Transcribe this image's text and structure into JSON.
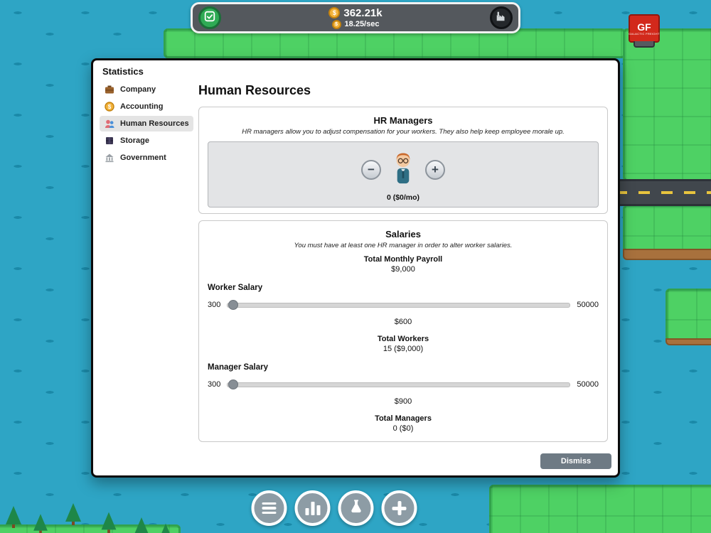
{
  "hud": {
    "money": "362.21k",
    "income_rate": "18.25/sec",
    "coin_symbol": "$"
  },
  "map": {
    "truck_logo": "GF",
    "truck_caption": "GALACTIC FREIGHT"
  },
  "modal": {
    "title": "Statistics",
    "page_title": "Human Resources",
    "sidebar": {
      "items": [
        {
          "label": "Company"
        },
        {
          "label": "Accounting"
        },
        {
          "label": "Human Resources"
        },
        {
          "label": "Storage"
        },
        {
          "label": "Government"
        }
      ]
    },
    "hr_managers": {
      "title": "HR Managers",
      "description": "HR managers allow you to adjust compensation for your workers. They also help keep employee morale up.",
      "minus_glyph": "−",
      "plus_glyph": "+",
      "count_label": "0 ($0/mo)"
    },
    "salaries": {
      "title": "Salaries",
      "note": "You must have at least one HR manager in order to alter worker salaries.",
      "payroll_label": "Total Monthly Payroll",
      "payroll_value": "$9,000",
      "worker": {
        "label": "Worker Salary",
        "min": "300",
        "max": "50000",
        "value": "$600",
        "total_label": "Total Workers",
        "total_value": "15 ($9,000)"
      },
      "manager": {
        "label": "Manager Salary",
        "min": "300",
        "max": "50000",
        "value": "$900",
        "total_label": "Total Managers",
        "total_value": "0 ($0)"
      }
    },
    "dismiss_label": "Dismiss"
  },
  "colors": {
    "water": "#2ea5c5",
    "grass": "#4ed164",
    "accent_gold": "#f2b33c",
    "hud_bar": "#54585d"
  }
}
